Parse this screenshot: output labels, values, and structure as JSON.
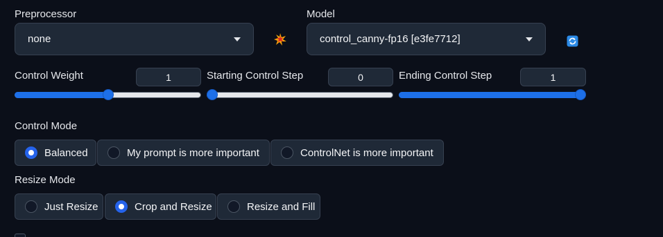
{
  "preprocessor": {
    "label": "Preprocessor",
    "value": "none",
    "icon": "collision-icon"
  },
  "model": {
    "label": "Model",
    "value": "control_canny-fp16 [e3fe7712]",
    "icon": "refresh-icon"
  },
  "sliders": {
    "control_weight": {
      "label": "Control Weight",
      "value": "1",
      "fraction": 0.5
    },
    "starting_step": {
      "label": "Starting Control Step",
      "value": "0",
      "fraction": 0.0
    },
    "ending_step": {
      "label": "Ending Control Step",
      "value": "1",
      "fraction": 1.0
    }
  },
  "control_mode": {
    "label": "Control Mode",
    "options": [
      "Balanced",
      "My prompt is more important",
      "ControlNet is more important"
    ],
    "selected": "Balanced"
  },
  "resize_mode": {
    "label": "Resize Mode",
    "options": [
      "Just Resize",
      "Crop and Resize",
      "Resize and Fill"
    ],
    "selected": "Crop and Resize"
  },
  "colors": {
    "accent": "#2563eb",
    "background": "#0b0f19",
    "panel": "#1f2937",
    "border": "#374151"
  }
}
